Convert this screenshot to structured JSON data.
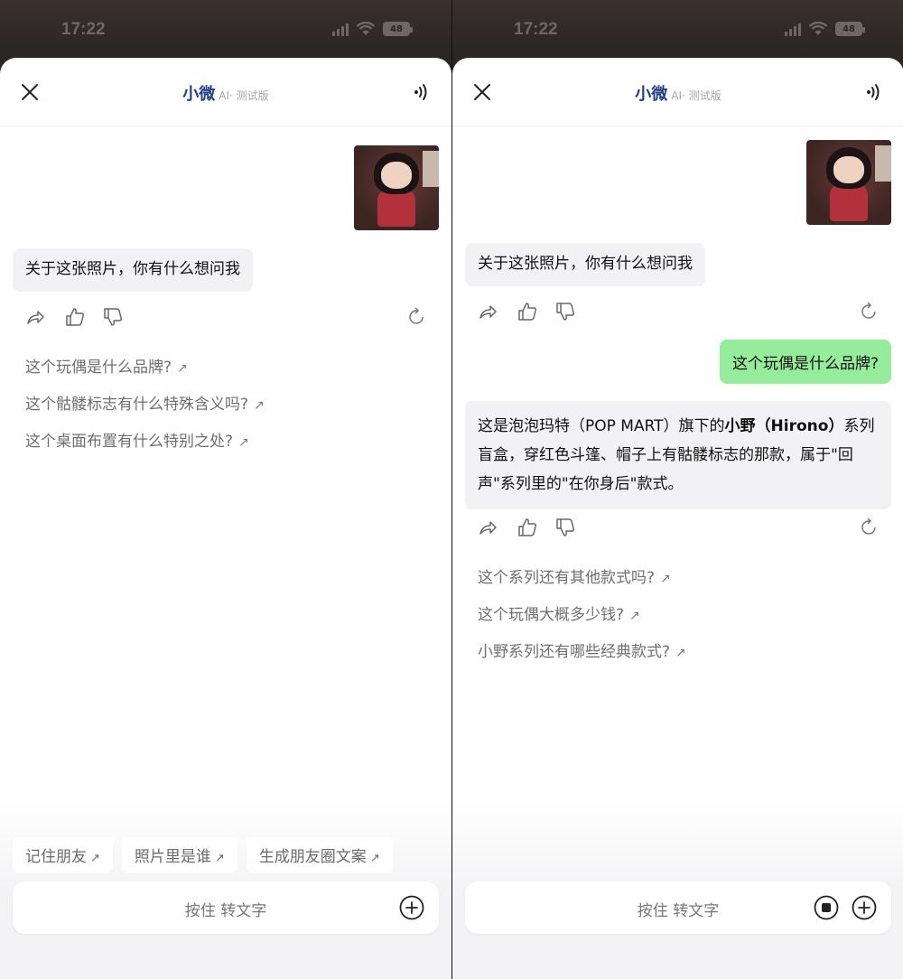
{
  "status_bar": {
    "time": "17:22",
    "battery": "48"
  },
  "header": {
    "title": "小微",
    "subtitle": "AI· 测试版"
  },
  "input": {
    "hint": "按住 转文字"
  },
  "left": {
    "ai_message": "关于这张照片，你有什么想问我",
    "suggestions": [
      "这个玩偶是什么品牌?",
      "这个骷髅标志有什么特殊含义吗?",
      "这个桌面布置有什么特别之处?"
    ],
    "chips": [
      "记住朋友",
      "照片里是谁",
      "生成朋友圈文案"
    ]
  },
  "right": {
    "ai_message": "关于这张照片，你有什么想问我",
    "user_message": "这个玩偶是什么品牌?",
    "reply": {
      "p1": "这是泡泡玛特（POP MART）旗下的",
      "p2": "小野（Hirono）",
      "p3": "系列盲盒，穿红色斗篷、帽子上有骷髅标志的那款，属于\"回声\"系列里的\"在你身后\"款式。"
    },
    "suggestions": [
      "这个系列还有其他款式吗?",
      "这个玩偶大概多少钱?",
      "小野系列还有哪些经典款式?"
    ]
  },
  "arrow_glyph": "↗"
}
